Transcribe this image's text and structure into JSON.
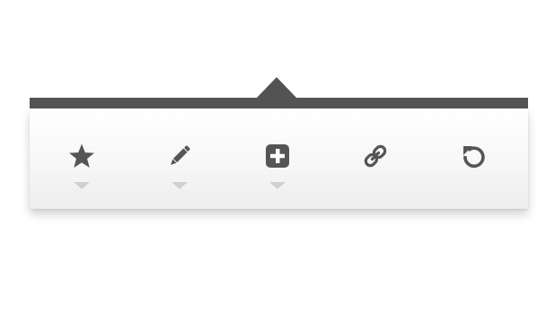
{
  "colors": {
    "bar": "#555254",
    "icon": "#575456",
    "caret": "#d0d0d0",
    "panel": "#f7f7f7"
  },
  "toolbar": {
    "items": [
      {
        "icon": "star-icon",
        "has_dropdown": true
      },
      {
        "icon": "pencil-icon",
        "has_dropdown": true
      },
      {
        "icon": "plus-box-icon",
        "has_dropdown": true
      },
      {
        "icon": "link-icon",
        "has_dropdown": false
      },
      {
        "icon": "refresh-icon",
        "has_dropdown": false
      }
    ]
  }
}
